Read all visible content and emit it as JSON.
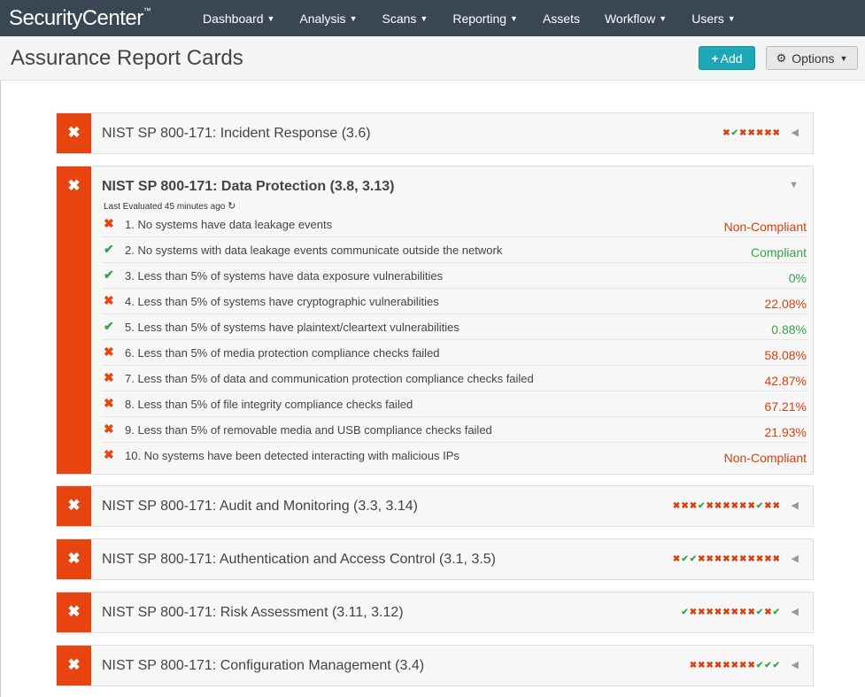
{
  "app": {
    "brand": "SecurityCenter",
    "brand_mark": "™"
  },
  "nav": [
    {
      "label": "Dashboard",
      "caret": true
    },
    {
      "label": "Analysis",
      "caret": true
    },
    {
      "label": "Scans",
      "caret": true
    },
    {
      "label": "Reporting",
      "caret": true
    },
    {
      "label": "Assets",
      "caret": false
    },
    {
      "label": "Workflow",
      "caret": true
    },
    {
      "label": "Users",
      "caret": true
    }
  ],
  "header": {
    "title": "Assurance Report Cards",
    "add_label": "Add",
    "add_icon": "+",
    "options_label": "Options",
    "options_icon": "gear-icon"
  },
  "colors": {
    "fail": "#e8440f",
    "pass": "#36a24a",
    "accent": "#1ea7b6",
    "navbar": "#3a4654"
  },
  "cards": [
    {
      "title": "NIST SP 800-171: Incident Response (3.6)",
      "marks": [
        "x",
        "c",
        "x",
        "x",
        "x",
        "x",
        "x"
      ],
      "expanded": false
    },
    {
      "title": "NIST SP 800-171: Data Protection (3.8, 3.13)",
      "expanded": true,
      "last_evaluated": "Last Evaluated 45 minutes ago",
      "rows": [
        {
          "status": "fail",
          "text": "1. No systems have data leakage events",
          "value": "Non-Compliant"
        },
        {
          "status": "pass",
          "text": "2. No systems with data leakage events communicate outside the network",
          "value": "Compliant"
        },
        {
          "status": "pass",
          "text": "3. Less than 5% of systems have data exposure vulnerabilities",
          "value": "0%"
        },
        {
          "status": "fail",
          "text": "4. Less than 5% of systems have cryptographic vulnerabilities",
          "value": "22.08%"
        },
        {
          "status": "pass",
          "text": "5. Less than 5% of systems have plaintext/cleartext vulnerabilities",
          "value": "0.88%"
        },
        {
          "status": "fail",
          "text": "6. Less than 5% of media protection compliance checks failed",
          "value": "58.08%"
        },
        {
          "status": "fail",
          "text": "7. Less than 5% of data and communication protection compliance checks failed",
          "value": "42.87%"
        },
        {
          "status": "fail",
          "text": "8. Less than 5% of file integrity compliance checks failed",
          "value": "67.21%"
        },
        {
          "status": "fail",
          "text": "9. Less than 5% of removable media and USB compliance checks failed",
          "value": "21.93%"
        },
        {
          "status": "fail",
          "text": "10. No systems have been detected interacting with malicious IPs",
          "value": "Non-Compliant"
        }
      ]
    },
    {
      "title": "NIST SP 800-171: Audit and Monitoring (3.3, 3.14)",
      "marks": [
        "x",
        "x",
        "x",
        "c",
        "x",
        "x",
        "x",
        "x",
        "x",
        "x",
        "c",
        "x",
        "x"
      ],
      "expanded": false
    },
    {
      "title": "NIST SP 800-171: Authentication and Access Control (3.1, 3.5)",
      "marks": [
        "x",
        "c",
        "c",
        "x",
        "x",
        "x",
        "x",
        "x",
        "x",
        "x",
        "x",
        "x",
        "x"
      ],
      "expanded": false
    },
    {
      "title": "NIST SP 800-171: Risk Assessment (3.11, 3.12)",
      "marks": [
        "c",
        "x",
        "x",
        "x",
        "x",
        "x",
        "x",
        "x",
        "x",
        "c",
        "x",
        "c"
      ],
      "expanded": false
    },
    {
      "title": "NIST SP 800-171: Configuration Management (3.4)",
      "marks": [
        "x",
        "x",
        "x",
        "x",
        "x",
        "x",
        "x",
        "x",
        "c",
        "c",
        "c"
      ],
      "expanded": false
    }
  ]
}
